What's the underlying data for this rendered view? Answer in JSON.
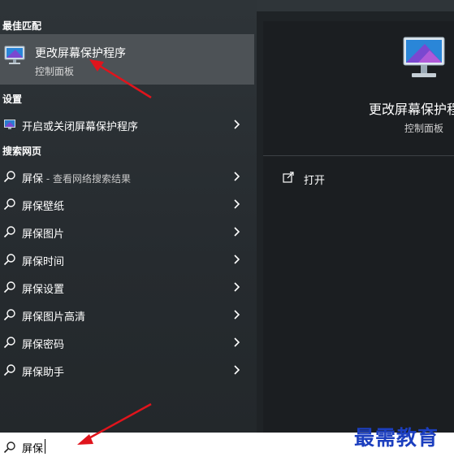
{
  "sections": {
    "best_match": "最佳匹配",
    "settings": "设置",
    "web_search": "搜索网页"
  },
  "best_match": {
    "title": "更改屏幕保护程序",
    "subtitle": "控制面板",
    "icon": "monitor-screensaver-icon"
  },
  "settings_items": [
    {
      "label": "开启或关闭屏幕保护程序",
      "icon": "monitor-small-icon"
    }
  ],
  "web_items": [
    {
      "label": "屏保",
      "sub": " - 查看网络搜索结果"
    },
    {
      "label": "屏保壁纸",
      "sub": ""
    },
    {
      "label": "屏保图片",
      "sub": ""
    },
    {
      "label": "屏保时间",
      "sub": ""
    },
    {
      "label": "屏保设置",
      "sub": ""
    },
    {
      "label": "屏保图片高清",
      "sub": ""
    },
    {
      "label": "屏保密码",
      "sub": ""
    },
    {
      "label": "屏保助手",
      "sub": ""
    }
  ],
  "preview": {
    "title": "更改屏幕保护程",
    "subtitle": "控制面板",
    "action_open": "打开"
  },
  "search": {
    "value": "屏保"
  },
  "watermark": "最需教育",
  "colors": {
    "accent_arrow": "#e0141c",
    "watermark": "#1c3fbf",
    "selected_bg": "#4d5256"
  }
}
